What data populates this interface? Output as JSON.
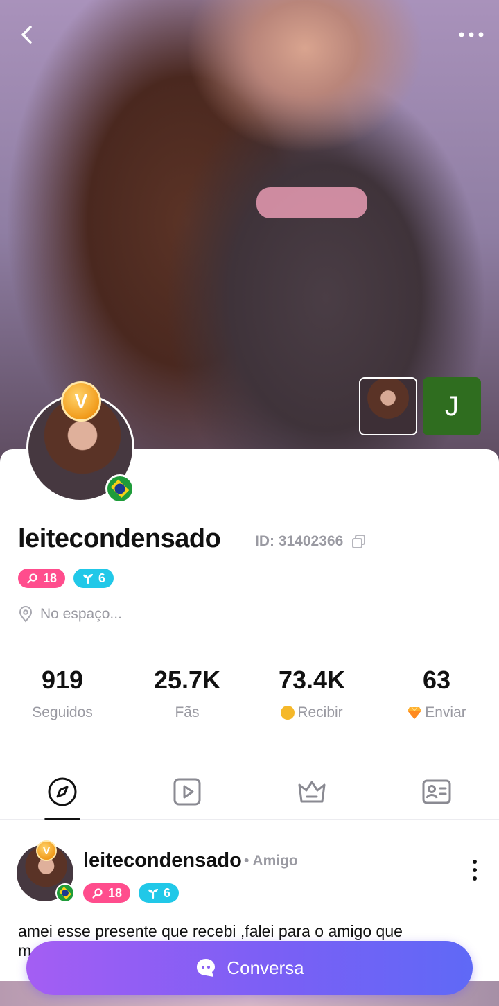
{
  "profile": {
    "username": "leitecondensado",
    "id_text": "ID: 31402366",
    "level_badge": "18",
    "growth_badge": "6",
    "location": "No espaço...",
    "vip_letter": "V",
    "thumbnail_letter": "J"
  },
  "stats": [
    {
      "value": "919",
      "label": "Seguidos"
    },
    {
      "value": "25.7K",
      "label": "Fãs"
    },
    {
      "value": "73.4K",
      "label": "Recibir"
    },
    {
      "value": "63",
      "label": "Enviar"
    }
  ],
  "tabs": [
    {
      "icon": "compass-icon"
    },
    {
      "icon": "video-play-icon"
    },
    {
      "icon": "crown-icon"
    },
    {
      "icon": "id-card-icon"
    }
  ],
  "post": {
    "author": "leitecondensado",
    "relation": "• Amigo",
    "level_badge": "18",
    "growth_badge": "6",
    "text_line1": "amei esse presente que recebi ,falei para o amigo que",
    "text_line2": "m"
  },
  "cta": {
    "label": "Conversa"
  },
  "colors": {
    "accent_start": "#a45ef3",
    "accent_end": "#5f69f6",
    "level_pink": "#ff4d8d",
    "growth_cyan": "#21c8e8"
  }
}
